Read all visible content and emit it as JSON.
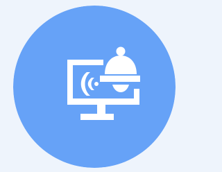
{
  "badge": {
    "background_color": "#eef4fc",
    "circle_color": "#66a2f7",
    "glyph_color": "#ffffff",
    "icon": "monitor-alert-bell-icon"
  }
}
